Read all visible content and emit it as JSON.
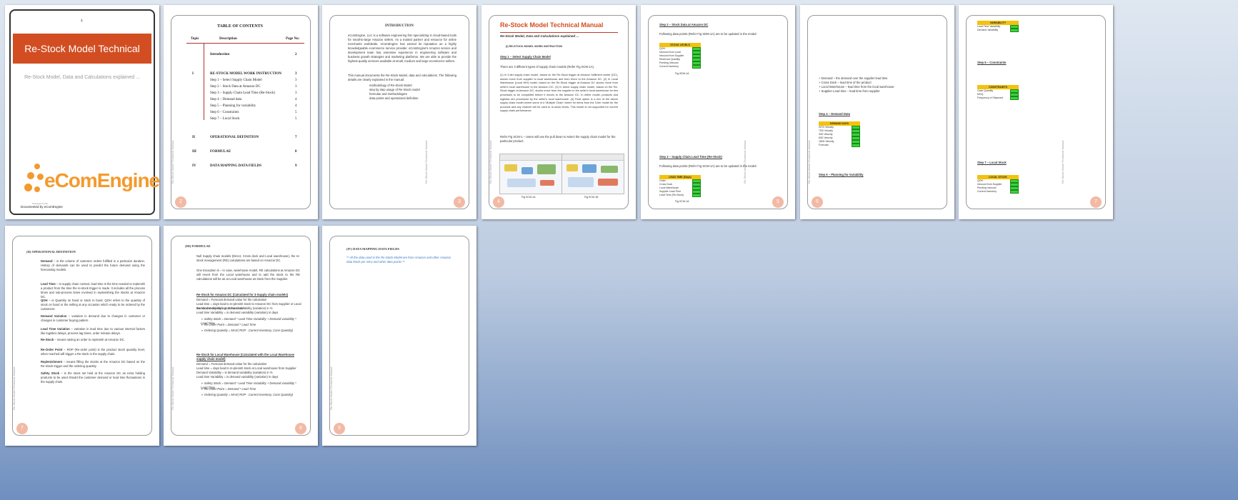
{
  "cover": {
    "mark": "¹",
    "title": "Re-Stock Model Technical Manual",
    "subtitle": "Re-Stock Model, Data and Calculations explained ...",
    "logo_text": "eComEngine",
    "prepared": "Prepared by Abc",
    "documented_by": "Documented by eComEngine"
  },
  "toc": {
    "title": "TABLE OF CONTENTS",
    "headers": [
      "Topic",
      "Description",
      "Page No:"
    ],
    "rows": [
      {
        "topic": "",
        "desc": "Introduction",
        "page": "2"
      },
      {
        "topic": "I",
        "desc": "RE-STOCK MODEL WORK INSTRUCTION",
        "page": "3"
      },
      {
        "topic": "",
        "desc": "Step 1 – Select Supply Chain Model",
        "page": "3"
      },
      {
        "topic": "",
        "desc": "Step 2 – Stock Data at Amazon DC",
        "page": "3"
      },
      {
        "topic": "",
        "desc": "Step 3 – Supply Chain Lead Time (Re-Stock)",
        "page": "3"
      },
      {
        "topic": "",
        "desc": "Step 4 – Demand data",
        "page": "4"
      },
      {
        "topic": "",
        "desc": "Step 5 – Planning for variability",
        "page": "4"
      },
      {
        "topic": "",
        "desc": "Step 6 – Constraints",
        "page": "5"
      },
      {
        "topic": "",
        "desc": "Step 7 – Local Stock",
        "page": "5"
      },
      {
        "topic": "II",
        "desc": "OPERATIONAL DEFINITION",
        "page": "7"
      },
      {
        "topic": "III",
        "desc": "FORMULAE",
        "page": "8"
      },
      {
        "topic": "IV",
        "desc": "DATA MAPPING DATA FIELDS",
        "page": "9"
      }
    ]
  },
  "page_numbers": [
    "1",
    "2",
    "3",
    "4",
    "5",
    "6",
    "7",
    "8",
    "9"
  ],
  "side_label": "Re-Stock Model Technical Manual",
  "intro": {
    "title": "INTRODUCTION",
    "p1": "eComEngine, LLC is a software engineering firm specializing in cloud-based tools for small-to-large Amazon sellers. As a trusted partner and resource for online merchants worldwide, eComEngine has earned its reputation as a highly knowledgeable ecommerce service provider. eComEngine's Amazon service and development team has extensive experience in engineering software and business growth strategies and marketing platforms. We are able to provide the highest-quality services available at small, medium and large ecommerce sellers.",
    "p2": "This manual documents the Re-Stock Model, data and calculations. The following details are clearly explained in the manual:",
    "list": [
      "methodology of Re-Stock Model",
      "step by step usage of Re-Stock model",
      "formulae and methodologies",
      "data points and operational definition"
    ]
  },
  "p4": {
    "title": "Re-Stock Model Technical Manual",
    "subtitle": "Re-Stock Model, Data and Calculations explained ...",
    "section": "(I)      RE-STOCK MODEL WORK INSTRUCTION",
    "step1": "Step 1 – Select Supply Chain Model",
    "intro": "There are 3 different types of supply chain models (Refer Fig SCM-1A).",
    "body": "(1) In 3-tier supply chain model, based on the Re-Stock trigger at Amazon fulfilment center (DC), stocks move from supplier to local warehouse and from there to the Amazon DC. (2) In Local Warehouse (Local WH) model, based on the Re-Stock trigger at Amazon DC stocks move from seller's local warehouse to the Amazon DC. (3) In direct supply chain model, based on the Re-Stock trigger at Amazon DC, stocks move from the supplier to the seller's local warehouse for few processes to be completed before it moves to the Amazon DC. In either model, products and logistics are processed by the seller's local warehouse. (4) Final option is a mix of the above supply chain model where some of a 'Multiple Chain' where for items from the 3-tier model for the products and any channel will be used to re-stock levels. This model is not supported for current supply chain performance.",
    "note": "Refer Fig SCM-1 – Users will use the pull down to select the supply chain model for the particular product.",
    "fig_a": "Fig.SCM-1A",
    "fig_b": "Fig.SCM-1B"
  },
  "p5": {
    "step2": "Step 2 – Stock Data at Amazon DC",
    "step2_desc": "Following data points (Refer Fig SDM-1A) are to be updated in the model:",
    "stock_table": {
      "header": "STOCK LEVELS",
      "rows": [
        "QOH",
        "Inbound from Local",
        "Inbound from Supplier",
        "Reserved Quantity",
        "Pending Inbound",
        "Current Inventory"
      ]
    },
    "fig": "Fig.SDM-1A",
    "step3": "Step 3 – Supply Chain Lead Time (Re-Stock)",
    "step3_desc": "Following data points (Refer Fig SCM-1A) are to be updated in the model:",
    "lead_table": {
      "header": "LEAD TIME (Days)",
      "rows": [
        "Order",
        "Cross Dock",
        "Local Warehouse",
        "Supplier Lead Time",
        "Lead Time (Re-Stock)"
      ]
    },
    "fig2": "Fig.SCM-1A"
  },
  "p6": {
    "step4": "Step 4 – Demand Data",
    "demand_table": {
      "header": "DEMAND DATA",
      "rows": [
        "WTD Velocity",
        "7DD Velocity",
        "30D Velocity",
        "60D Velocity",
        "180D Velocity",
        "Forecast"
      ]
    },
    "step5": "Step 5 – Planning for Variability",
    "list": [
      "+ Demand – the demand over the supplier lead time",
      "+ Cross Dock – lead time of the product",
      "+ Local Warehouse – lead time from the local warehouse",
      "+ Supplier Lead time – lead time from supplier"
    ]
  },
  "p7": {
    "table1": {
      "header": "VARIABILITY",
      "rows": [
        "Lead Time Variability",
        "Demand Variability"
      ]
    },
    "step6": "Step 6 – Constraints",
    "constraints_table": {
      "header": "CONSTRAINTS",
      "rows": [
        "Case Quantity",
        "MOQ",
        "Frequency of Shipment"
      ]
    },
    "step7": "Step 7 – Local Stock",
    "local_table": {
      "header": "LOCAL STOCK",
      "rows": [
        "QOH",
        "Inbound from Supplier",
        "Pending Inbound",
        "Current Inventory"
      ]
    }
  },
  "p8": {
    "section": "(II)     OPERATIONAL DEFINITION",
    "terms": [
      {
        "term": "Demand",
        "def": "is the volume of customer orders fulfilled in a particular duration. History of demands can be used to predict the future demand using the forecasting models."
      },
      {
        "term": "Lead Time",
        "def": "In supply chain context, lead time is the time needed to replenish a product from the time the re-stock trigger is made. It includes all the process times and sub-process times involved in replenishing the stocks at Amazon DC."
      },
      {
        "term": "QOH",
        "def": "is Quantity on hand or stock in hand. QOH refers to the quantity of stock on hand or the selling at any occasion which ready to be ordered by the customers."
      },
      {
        "term": "Demand Variation",
        "def": "variation in demand due to changes in customer or changes in customer buying pattern."
      },
      {
        "term": "Lead Time Variation",
        "def": "variation in lead time due to various internal factors like logistics delays, process lag times, order release delays."
      },
      {
        "term": "Re-Stock",
        "def": "means raising an order to replenish at Amazon DC."
      },
      {
        "term": "Re-Order Point",
        "def": "ROP (Re-order point) is the product stock quantity level, when reached will trigger a Re-stock in the supply chain."
      },
      {
        "term": "Replenishment",
        "def": "means filling the stocks at the Amazon DC based on the Re-Stock trigger and the ordering quantity."
      },
      {
        "term": "Safety Stock",
        "def": "is the stock set held at the Amazon DC as extra holding products to be used should the customer demand or lead time fluctuations in the supply chain."
      }
    ]
  },
  "p9": {
    "section": "(III)    FORMULAE",
    "p1": "Null Supply chain models (Direct, Cross dock and Local warehouse), the re-stock management (RE) calculations are based on Amazon DC.",
    "p2": "One Exception is – in case, warehouse model, RE calculations at Amazon DC will revert from the Local warehouse and to add the stock to the RE calculations will be as at Local warehouse as stock from the Supplier.",
    "h1": "Re-Stock for Amazon DC (Calculated for 3-Supply chain models)",
    "h1_lines": [
      "Demand = Forecast demand value for the calculation",
      "Lead time = days lead to re-plenish stock to Amazon DC from Supplier or Local warehouse depending on the model",
      "Demand Variability = is demand variability (variation) in %",
      "Lead time Variability = is demand variability (variation) in days"
    ],
    "h1_bullets": [
      "Safety Stock = Demand * Lead Time Variability + Demand variability * Lead Time",
      "Re-Order Point = Demand * Lead Time",
      "Ordering Quantity = MAX( ROP - Current Inventory, Case Quantity)"
    ],
    "h2": "Re-Stock for Local Warehouse (Calculated with the Local Warehouse supply chain model)",
    "h2_lines": [
      "Demand = Forecast demand value for the calculation",
      "Lead time = days lead to re-plenish stock at Local warehouse from Supplier",
      "Demand Variability = is demand variability (variation) in %",
      "Lead time Variability = is demand variability (variation) in days"
    ],
    "h2_bullets": [
      "Safety Stock = Demand * Lead Time Variability + Demand variability * Lead Time",
      "Re-Order Point = Demand * Lead Time",
      "Ordering Quantity = MAX( ROP - Current Inventory, Case Quantity)"
    ]
  },
  "p10": {
    "section": "(IV)     DATA MAPPING DATA FIELDS",
    "note": "** All the data used in the Re-Stock Model are from Amazon and other Amazon data feeds per SKU and other data points **"
  }
}
